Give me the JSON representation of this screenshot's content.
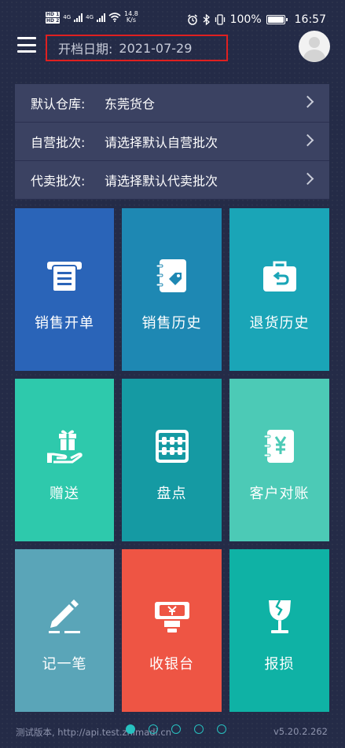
{
  "status_bar": {
    "hd1": "HD 1",
    "hd2": "HD 2",
    "net1": "4G",
    "net2": "4G",
    "speed": "14.8",
    "speed_unit": "K/s",
    "battery": "100%",
    "time": "16:57"
  },
  "header": {
    "date_label": "开档日期:",
    "date_value": "2021-07-29",
    "highlight_color": "#e02020"
  },
  "settings": [
    {
      "label": "默认仓库:",
      "value": "东莞货仓"
    },
    {
      "label": "自营批次:",
      "value": "请选择默认自营批次"
    },
    {
      "label": "代卖批次:",
      "value": "请选择默认代卖批次"
    }
  ],
  "tiles": [
    {
      "label": "销售开单",
      "icon": "receipt-printer-icon",
      "color": "#2a64b8"
    },
    {
      "label": "销售历史",
      "icon": "notebook-tag-icon",
      "color": "#1e88b3"
    },
    {
      "label": "退货历史",
      "icon": "return-bag-icon",
      "color": "#1aa5b7"
    },
    {
      "label": "赠送",
      "icon": "gift-hand-icon",
      "color": "#2ec9ac"
    },
    {
      "label": "盘点",
      "icon": "abacus-icon",
      "color": "#159aa3"
    },
    {
      "label": "客户对账",
      "icon": "yuan-notebook-icon",
      "color": "#4ccab6"
    },
    {
      "label": "记一笔",
      "icon": "pencil-note-icon",
      "color": "#5aa5b8"
    },
    {
      "label": "收银台",
      "icon": "cashier-icon",
      "color": "#ee5544"
    },
    {
      "label": "报损",
      "icon": "broken-glass-icon",
      "color": "#0fb2a5"
    }
  ],
  "footer": {
    "version_text": "测试版本, http://api.test.zhimadi.cn",
    "version_number": "v5.20.2.262",
    "page_dots": 5,
    "active_dot": 0,
    "dot_color": "#27c1c0"
  }
}
